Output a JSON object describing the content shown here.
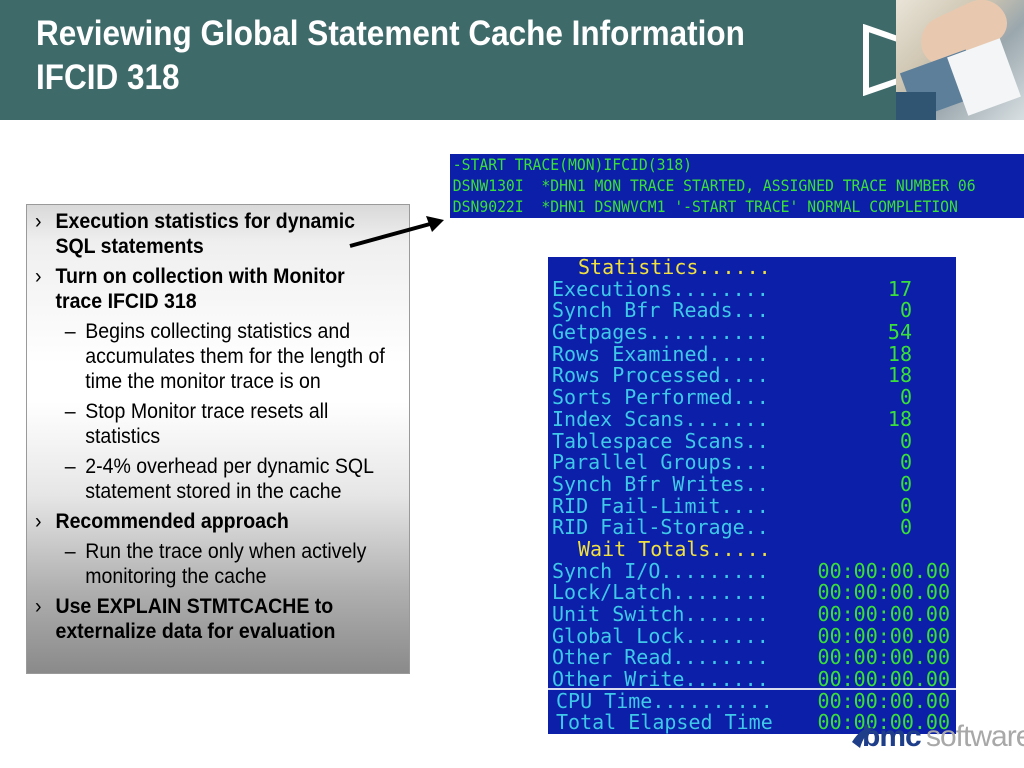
{
  "slide": {
    "title_line1": "Reviewing Global Statement Cache Information",
    "title_line2": "IFCID 318"
  },
  "colors": {
    "header_bg": "#3f6a6a",
    "terminal_bg": "#0b1fa8",
    "terminal_green": "#3ae03a",
    "terminal_cyan": "#3fc8e8",
    "terminal_yellow": "#f0e040",
    "logo_blue": "#1f3e8a"
  },
  "icons": {
    "play": "play-outline-icon",
    "arrow": "pointer-arrow-icon"
  },
  "bullets": {
    "b1": "Execution statistics for dynamic SQL statements",
    "b2": "Turn on collection with Monitor trace IFCID 318",
    "b2_sub1": "Begins collecting statistics and accumulates them for the length of time the monitor trace is on",
    "b2_sub2": "Stop Monitor trace resets all statistics",
    "b2_sub3": "2-4% overhead per dynamic SQL statement stored in the cache",
    "b3": "Recommended approach",
    "b3_sub1": "Run the trace only when actively monitoring the cache",
    "b4": "Use EXPLAIN STMTCACHE to externalize data for evaluation"
  },
  "trace": {
    "line1": "-START TRACE(MON)IFCID(318)",
    "line2": "DSNW130I  *DHN1 MON TRACE STARTED, ASSIGNED TRACE NUMBER 06",
    "line3": "DSN9022I  *DHN1 DSNWVCM1 '-START TRACE' NORMAL COMPLETION"
  },
  "stats": {
    "header": "Statistics......",
    "rows": [
      {
        "label": "Executions........",
        "value": "17"
      },
      {
        "label": "Synch Bfr Reads...",
        "value": "0"
      },
      {
        "label": "Getpages..........",
        "value": "54"
      },
      {
        "label": "Rows Examined.....",
        "value": "18"
      },
      {
        "label": "Rows Processed....",
        "value": "18"
      },
      {
        "label": "Sorts Performed...",
        "value": "0"
      },
      {
        "label": "Index Scans.......",
        "value": "18"
      },
      {
        "label": "Tablespace Scans..",
        "value": "0"
      },
      {
        "label": "Parallel Groups...",
        "value": "0"
      },
      {
        "label": "Synch Bfr Writes..",
        "value": "0"
      },
      {
        "label": "RID Fail-Limit....",
        "value": "0"
      },
      {
        "label": "RID Fail-Storage..",
        "value": "0"
      }
    ]
  },
  "waits": {
    "header": "Wait Totals.....",
    "rows": [
      {
        "label": "Synch I/O.........",
        "value": "00:00:00.00"
      },
      {
        "label": "Lock/Latch........",
        "value": "00:00:00.00"
      },
      {
        "label": "Unit Switch.......",
        "value": "00:00:00.00"
      },
      {
        "label": "Global Lock.......",
        "value": "00:00:00.00"
      },
      {
        "label": "Other Read........",
        "value": "00:00:00.00"
      },
      {
        "label": "Other Write.......",
        "value": "00:00:00.00"
      }
    ]
  },
  "totals": {
    "cpu_label": "CPU Time..........",
    "cpu_value": "00:00:00.00",
    "elapsed_label": "Total Elapsed Time",
    "elapsed_value": "00:00:00.00"
  },
  "logo": {
    "brand": "bmc",
    "suffix": "software"
  }
}
